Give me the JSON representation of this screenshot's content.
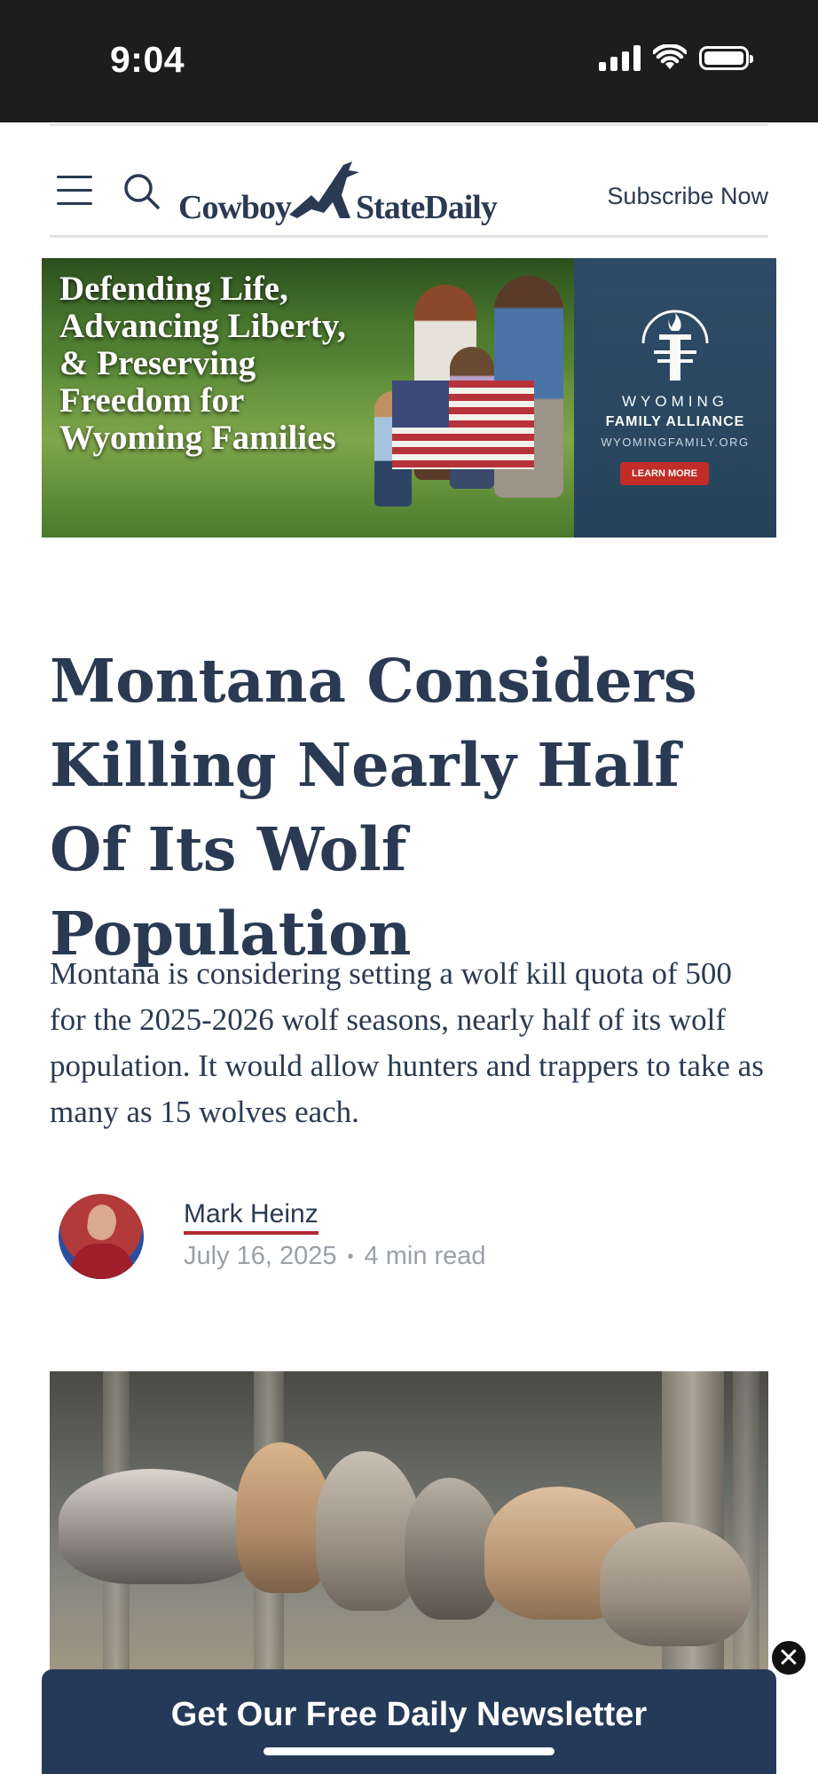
{
  "status_bar": {
    "time": "9:04"
  },
  "header": {
    "logo_left": "Cowboy",
    "logo_right": "StateDaily",
    "subscribe_label": "Subscribe Now"
  },
  "ad": {
    "headline": "Defending Life, Advancing Liberty, & Preserving Freedom for Wyoming Families",
    "org_line1": "WYOMING",
    "org_line2": "FAMILY ALLIANCE",
    "org_url": "WYOMINGFAMILY.ORG",
    "button_label": "LEARN MORE"
  },
  "article": {
    "title": "Montana Considers Killing Nearly Half Of Its Wolf Population",
    "dek": "Montana is considering setting a wolf kill quota of 500 for the 2025-2026 wolf seasons, nearly half of its wolf population. It would allow hunters and trappers to take as many as 15 wolves each.",
    "author": "Mark Heinz",
    "date": "July 16, 2025",
    "read_time": "4 min read"
  },
  "newsletter": {
    "label": "Get Our Free Daily Newsletter",
    "close_symbol": "✕"
  },
  "colors": {
    "navy": "#2a3a52",
    "accent_red": "#b22a33",
    "newsletter_bg": "#243a58"
  }
}
